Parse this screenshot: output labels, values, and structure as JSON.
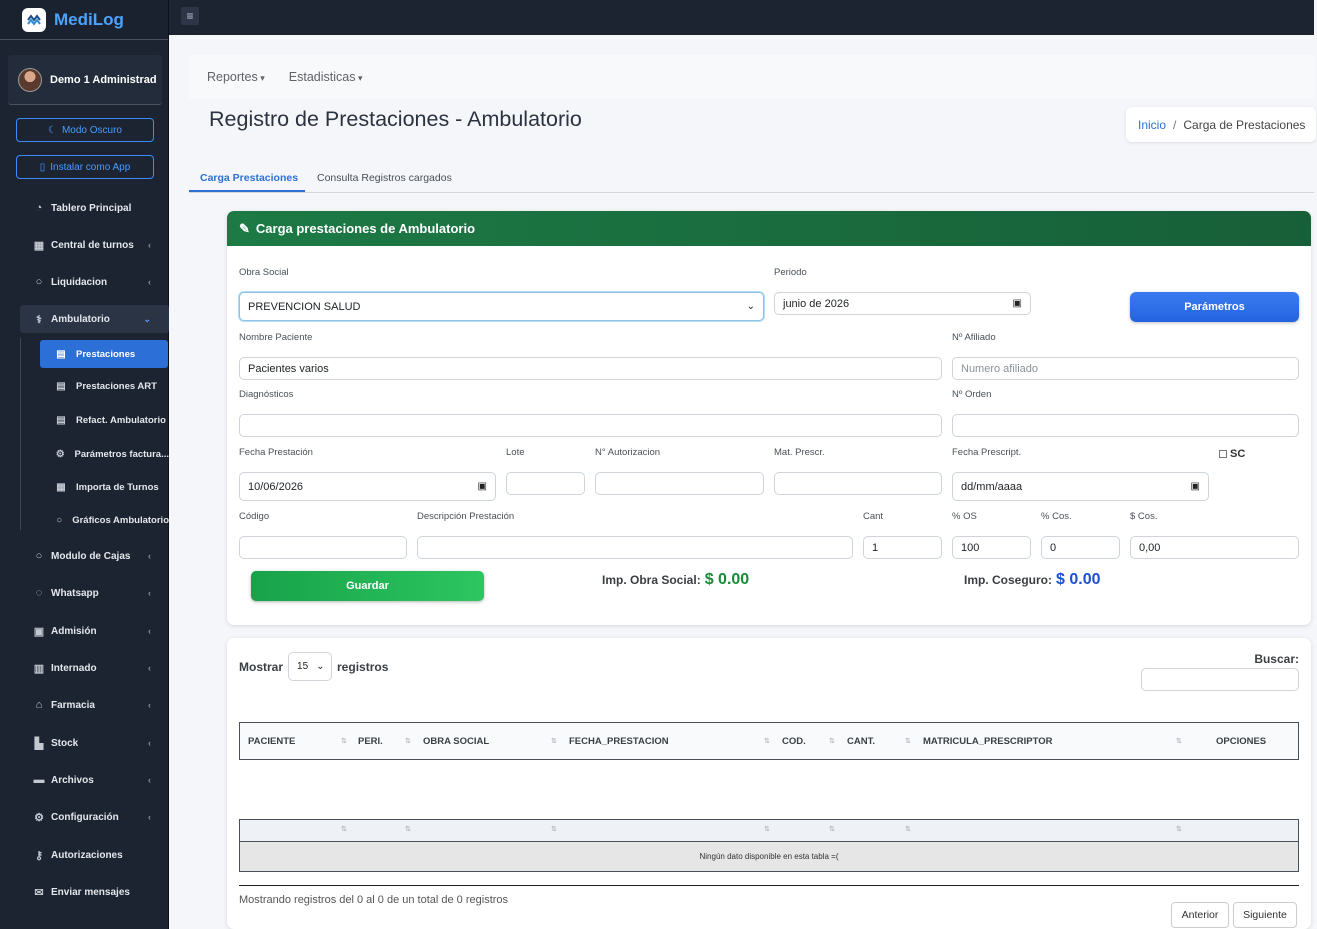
{
  "app": {
    "name": "MediLog"
  },
  "user": {
    "name": "Demo 1 Administrad"
  },
  "sidebar_buttons": {
    "dark_mode": "Modo Oscuro",
    "install_app": "Instalar como App"
  },
  "nav": [
    {
      "label": "Tablero Principal",
      "icon": "dashboard-icon"
    },
    {
      "label": "Central de turnos",
      "icon": "calendar-icon"
    },
    {
      "label": "Liquidacion",
      "icon": "circle-icon"
    },
    {
      "label": "Ambulatorio",
      "icon": "stethoscope-icon"
    },
    {
      "label": "Modulo de Cajas",
      "icon": "circle-icon"
    },
    {
      "label": "Whatsapp",
      "icon": "whatsapp-icon"
    },
    {
      "label": "Admisión",
      "icon": "hospital-user-icon"
    },
    {
      "label": "Internado",
      "icon": "hospital-icon"
    },
    {
      "label": "Farmacia",
      "icon": "clinic-icon"
    },
    {
      "label": "Stock",
      "icon": "boxes-icon"
    },
    {
      "label": "Archivos",
      "icon": "folder-icon"
    },
    {
      "label": "Configuración",
      "icon": "gear-icon"
    },
    {
      "label": "Autorizaciones",
      "icon": "key-icon"
    },
    {
      "label": "Enviar mensajes",
      "icon": "envelope-icon"
    }
  ],
  "subnav_ambulatorio": [
    {
      "label": "Prestaciones",
      "icon": "file-medical-icon"
    },
    {
      "label": "Prestaciones ART",
      "icon": "file-icon"
    },
    {
      "label": "Refact. Ambulatorio",
      "icon": "file-icon"
    },
    {
      "label": "Parámetros factura...",
      "icon": "cogs-icon"
    },
    {
      "label": "Importa de Turnos",
      "icon": "calendar-icon"
    },
    {
      "label": "Gráficos Ambulatorio",
      "icon": "circle-icon"
    }
  ],
  "topnav": {
    "reportes": "Reportes",
    "estadisticas": "Estadisticas"
  },
  "page": {
    "title": "Registro de Prestaciones - Ambulatorio"
  },
  "breadcrumb": {
    "home": "Inicio",
    "sep": "/",
    "current": "Carga de Prestaciones"
  },
  "tabs": {
    "carga": "Carga Prestaciones",
    "consulta": "Consulta Registros cargados"
  },
  "form": {
    "header": "Carga prestaciones de Ambulatorio",
    "obra_social_label": "Obra Social",
    "obra_social_value": "PREVENCION SALUD",
    "periodo_label": "Periodo",
    "periodo_value": "junio de 2026",
    "parametros_button": "Parámetros",
    "nombre_label": "Nombre Paciente",
    "nombre_value": "Pacientes varios",
    "afiliado_label": "Nº Afiliado",
    "afiliado_placeholder": "Numero afiliado",
    "diagnosticos_label": "Diagnósticos",
    "orden_label": "Nº Orden",
    "fecha_prest_label": "Fecha Prestación",
    "fecha_prest_value": "10/06/2026",
    "lote_label": "Lote",
    "autorizacion_label": "N° Autorizacion",
    "mat_prescr_label": "Mat. Prescr.",
    "fecha_prescript_label": "Fecha Prescript.",
    "fecha_prescript_value": "dd/mm/aaaa",
    "sc_label": "SC",
    "codigo_label": "Código",
    "descripcion_label": "Descripción Prestación",
    "cant_label": "Cant",
    "cant_value": "1",
    "pct_os_label": "% OS",
    "pct_os_value": "100",
    "pct_cos_label": "% Cos.",
    "pct_cos_value": "0",
    "cos_label": "$ Cos.",
    "cos_value": "0,00",
    "guardar_button": "Guardar",
    "imp_os_label": "Imp. Obra Social:",
    "imp_os_value": "$ 0.00",
    "imp_cos_label": "Imp. Coseguro:",
    "imp_cos_value": "$ 0.00"
  },
  "table": {
    "mostrar": "Mostrar",
    "page_size": "15",
    "registros": "registros",
    "buscar": "Buscar:",
    "columns": [
      "PACIENTE",
      "PERI.",
      "OBRA SOCIAL",
      "FECHA_PRESTACION",
      "COD.",
      "CANT.",
      "MATRICULA_PRESCRIPTOR",
      "OPCIONES"
    ],
    "empty": "Ningún dato disponible en esta tabla =(",
    "info": "Mostrando registros del 0 al 0 de un total de 0 registros",
    "prev": "Anterior",
    "next": "Siguiente"
  },
  "colors": {
    "sidebar": "#1c2431",
    "accent": "#2c6fd6",
    "card_header": "#1d7a45",
    "save": "#18a24a"
  }
}
